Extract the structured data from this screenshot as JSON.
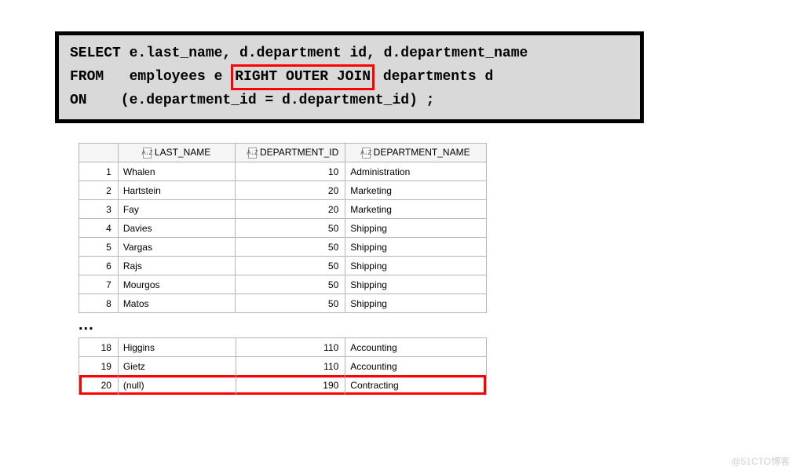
{
  "sql": {
    "line1a": "SELECT e.last_name, d.department id, d.department_name",
    "line2a": "FROM   employees e ",
    "highlight": "RIGHT OUTER JOIN",
    "line2b": " departments d",
    "line3": "ON    (e.department_id = d.department_id) ;"
  },
  "table": {
    "headers": [
      "LAST_NAME",
      "DEPARTMENT_ID",
      "DEPARTMENT_NAME"
    ],
    "sort_glyph": "A↓Z",
    "rows_top": [
      {
        "n": 1,
        "last": "Whalen",
        "dept_id": 10,
        "dept_name": "Administration"
      },
      {
        "n": 2,
        "last": "Hartstein",
        "dept_id": 20,
        "dept_name": "Marketing"
      },
      {
        "n": 3,
        "last": "Fay",
        "dept_id": 20,
        "dept_name": "Marketing"
      },
      {
        "n": 4,
        "last": "Davies",
        "dept_id": 50,
        "dept_name": "Shipping"
      },
      {
        "n": 5,
        "last": "Vargas",
        "dept_id": 50,
        "dept_name": "Shipping"
      },
      {
        "n": 6,
        "last": "Rajs",
        "dept_id": 50,
        "dept_name": "Shipping"
      },
      {
        "n": 7,
        "last": "Mourgos",
        "dept_id": 50,
        "dept_name": "Shipping"
      },
      {
        "n": 8,
        "last": "Matos",
        "dept_id": 50,
        "dept_name": "Shipping"
      }
    ],
    "ellipsis": "...",
    "rows_bottom": [
      {
        "n": 18,
        "last": "Higgins",
        "dept_id": 110,
        "dept_name": "Accounting"
      },
      {
        "n": 19,
        "last": "Gietz",
        "dept_id": 110,
        "dept_name": "Accounting"
      },
      {
        "n": 20,
        "last": "(null)",
        "dept_id": 190,
        "dept_name": "Contracting",
        "highlight": true
      }
    ]
  },
  "watermark": "@51CTO博客"
}
